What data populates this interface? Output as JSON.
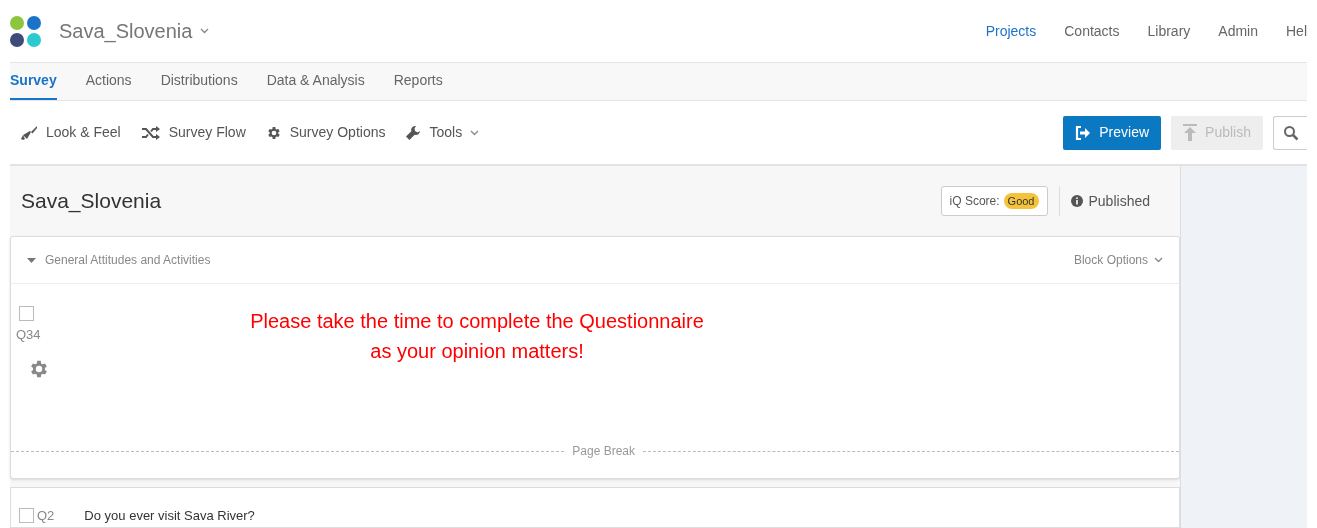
{
  "header": {
    "project_title": "Sava_Slovenia",
    "nav": [
      {
        "label": "Projects",
        "selected": true
      },
      {
        "label": "Contacts",
        "selected": false
      },
      {
        "label": "Library",
        "selected": false
      },
      {
        "label": "Admin",
        "selected": false
      },
      {
        "label": "Hel",
        "selected": false
      }
    ]
  },
  "tabs": [
    {
      "label": "Survey",
      "selected": true
    },
    {
      "label": "Actions",
      "selected": false
    },
    {
      "label": "Distributions",
      "selected": false
    },
    {
      "label": "Data & Analysis",
      "selected": false
    },
    {
      "label": "Reports",
      "selected": false
    }
  ],
  "toolbar": {
    "tools": [
      {
        "label": "Look & Feel",
        "kind": "brush",
        "dropdown": false
      },
      {
        "label": "Survey Flow",
        "kind": "flow",
        "dropdown": false
      },
      {
        "label": "Survey Options",
        "kind": "gear",
        "dropdown": false
      },
      {
        "label": "Tools",
        "kind": "wrench",
        "dropdown": true
      }
    ],
    "preview": {
      "label": "Preview",
      "disabled": false
    },
    "publish": {
      "label": "Publish",
      "disabled": true
    }
  },
  "survey": {
    "title": "Sava_Slovenia",
    "iq_label": "iQ Score:",
    "iq_value": "Good",
    "status": "Published"
  },
  "block": {
    "title": "General Attitudes and Activities",
    "expanded": true,
    "options": "Block Options",
    "question": {
      "number": "Q34",
      "checked": false,
      "lines": [
        "Please take the time to complete the Questionnaire",
        "as your opinion matters!"
      ]
    },
    "page_break": "Page Break"
  },
  "next_question": {
    "number": "Q2",
    "checked": false,
    "text": "Do you ever visit Sava River?"
  }
}
